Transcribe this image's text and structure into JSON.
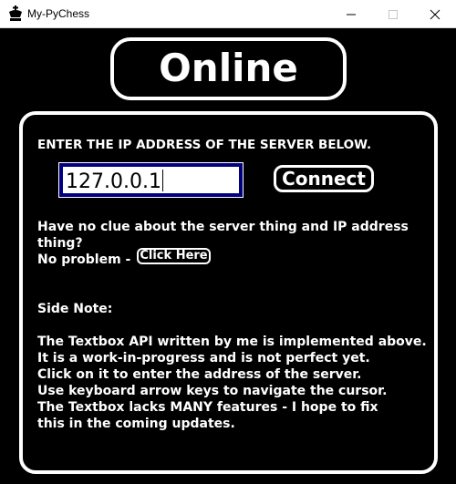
{
  "window": {
    "title": "My-PyChess",
    "icon": "chess-king-icon"
  },
  "header": {
    "title": "Online"
  },
  "panel": {
    "instruction": "ENTER THE IP ADDRESS OF THE SERVER BELOW.",
    "ip_input": {
      "value": "127.0.0.1"
    },
    "connect_label": "Connect",
    "help_line1": "Have no clue about the server thing and IP address",
    "help_line2": "thing?",
    "help_line3": "No problem -",
    "click_here_label": "Click Here",
    "side_note_title": "Side Note:",
    "note_lines": [
      "The Textbox API written by me is implemented above.",
      "It is a work-in-progress and is not perfect yet.",
      "Click on it to enter the address of the server.",
      "Use keyboard arrow keys to navigate the cursor.",
      "The Textbox lacks MANY features - I hope to fix",
      "this in the coming updates."
    ]
  },
  "colors": {
    "background": "#000000",
    "foreground": "#ffffff",
    "input_border": "#000080"
  }
}
